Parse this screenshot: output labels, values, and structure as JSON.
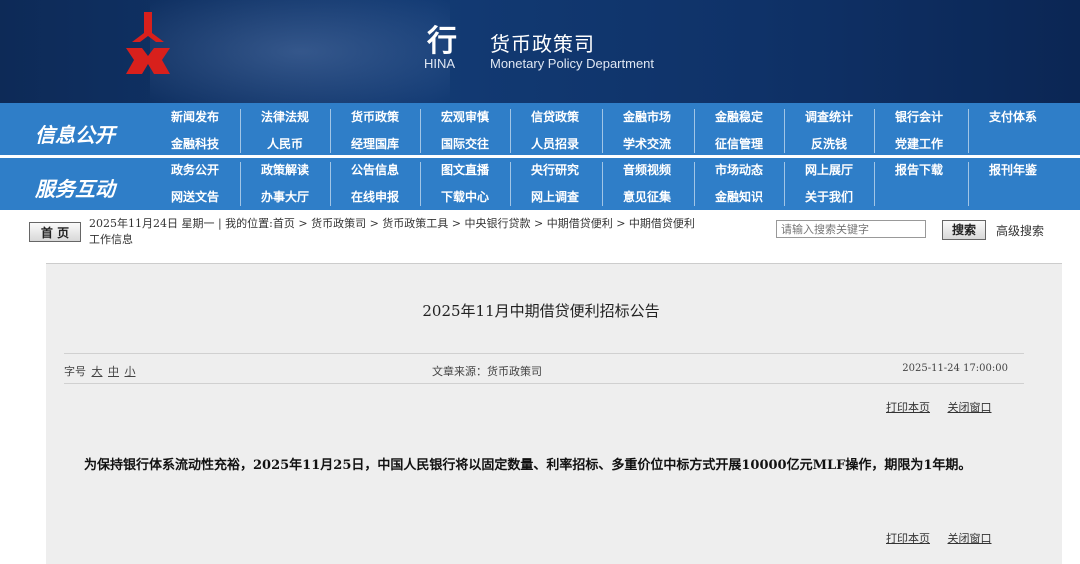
{
  "header": {
    "brand_char": "行",
    "brand_china": "HINA",
    "title": "货币政策司",
    "subtitle": "Monetary Policy Department"
  },
  "nav": {
    "group1_label": "信息公开",
    "group2_label": "服务互动",
    "row1": [
      "新闻发布",
      "法律法规",
      "货币政策",
      "宏观审慎",
      "信贷政策",
      "金融市场",
      "金融稳定",
      "调查统计",
      "银行会计",
      "支付体系"
    ],
    "row2": [
      "金融科技",
      "人民币",
      "经理国库",
      "国际交往",
      "人员招录",
      "学术交流",
      "征信管理",
      "反洗钱",
      "党建工作"
    ],
    "row3": [
      "政务公开",
      "政策解读",
      "公告信息",
      "图文直播",
      "央行研究",
      "音频视频",
      "市场动态",
      "网上展厅",
      "报告下载",
      "报刊年鉴"
    ],
    "row4": [
      "网送文告",
      "办事大厅",
      "在线申报",
      "下载中心",
      "网上调查",
      "意见征集",
      "金融知识",
      "关于我们"
    ]
  },
  "infobar": {
    "home": "首 页",
    "crumb_line1": "2025年11月24日 星期一 | 我的位置:首页 > 货币政策司 > 货币政策工具 > 中央银行贷款 > 中期借贷便利 > 中期借贷便利",
    "crumb_line2": "工作信息",
    "search_placeholder": "请输入搜索关键字",
    "search_button": "搜索",
    "advanced": "高级搜索"
  },
  "article": {
    "title": "2025年11月中期借贷便利招标公告",
    "font_label": "字号",
    "font_large": "大",
    "font_mid": "中",
    "font_small": "小",
    "source": "文章来源：货币政策司",
    "datetime": "2025-11-24 17:00:00",
    "print": "打印本页",
    "close": "关闭窗口",
    "body": "为保持银行体系流动性充裕，2025年11月25日，中国人民银行将以固定数量、利率招标、多重价位中标方式开展10000亿元MLF操作，期限为1年期。"
  }
}
